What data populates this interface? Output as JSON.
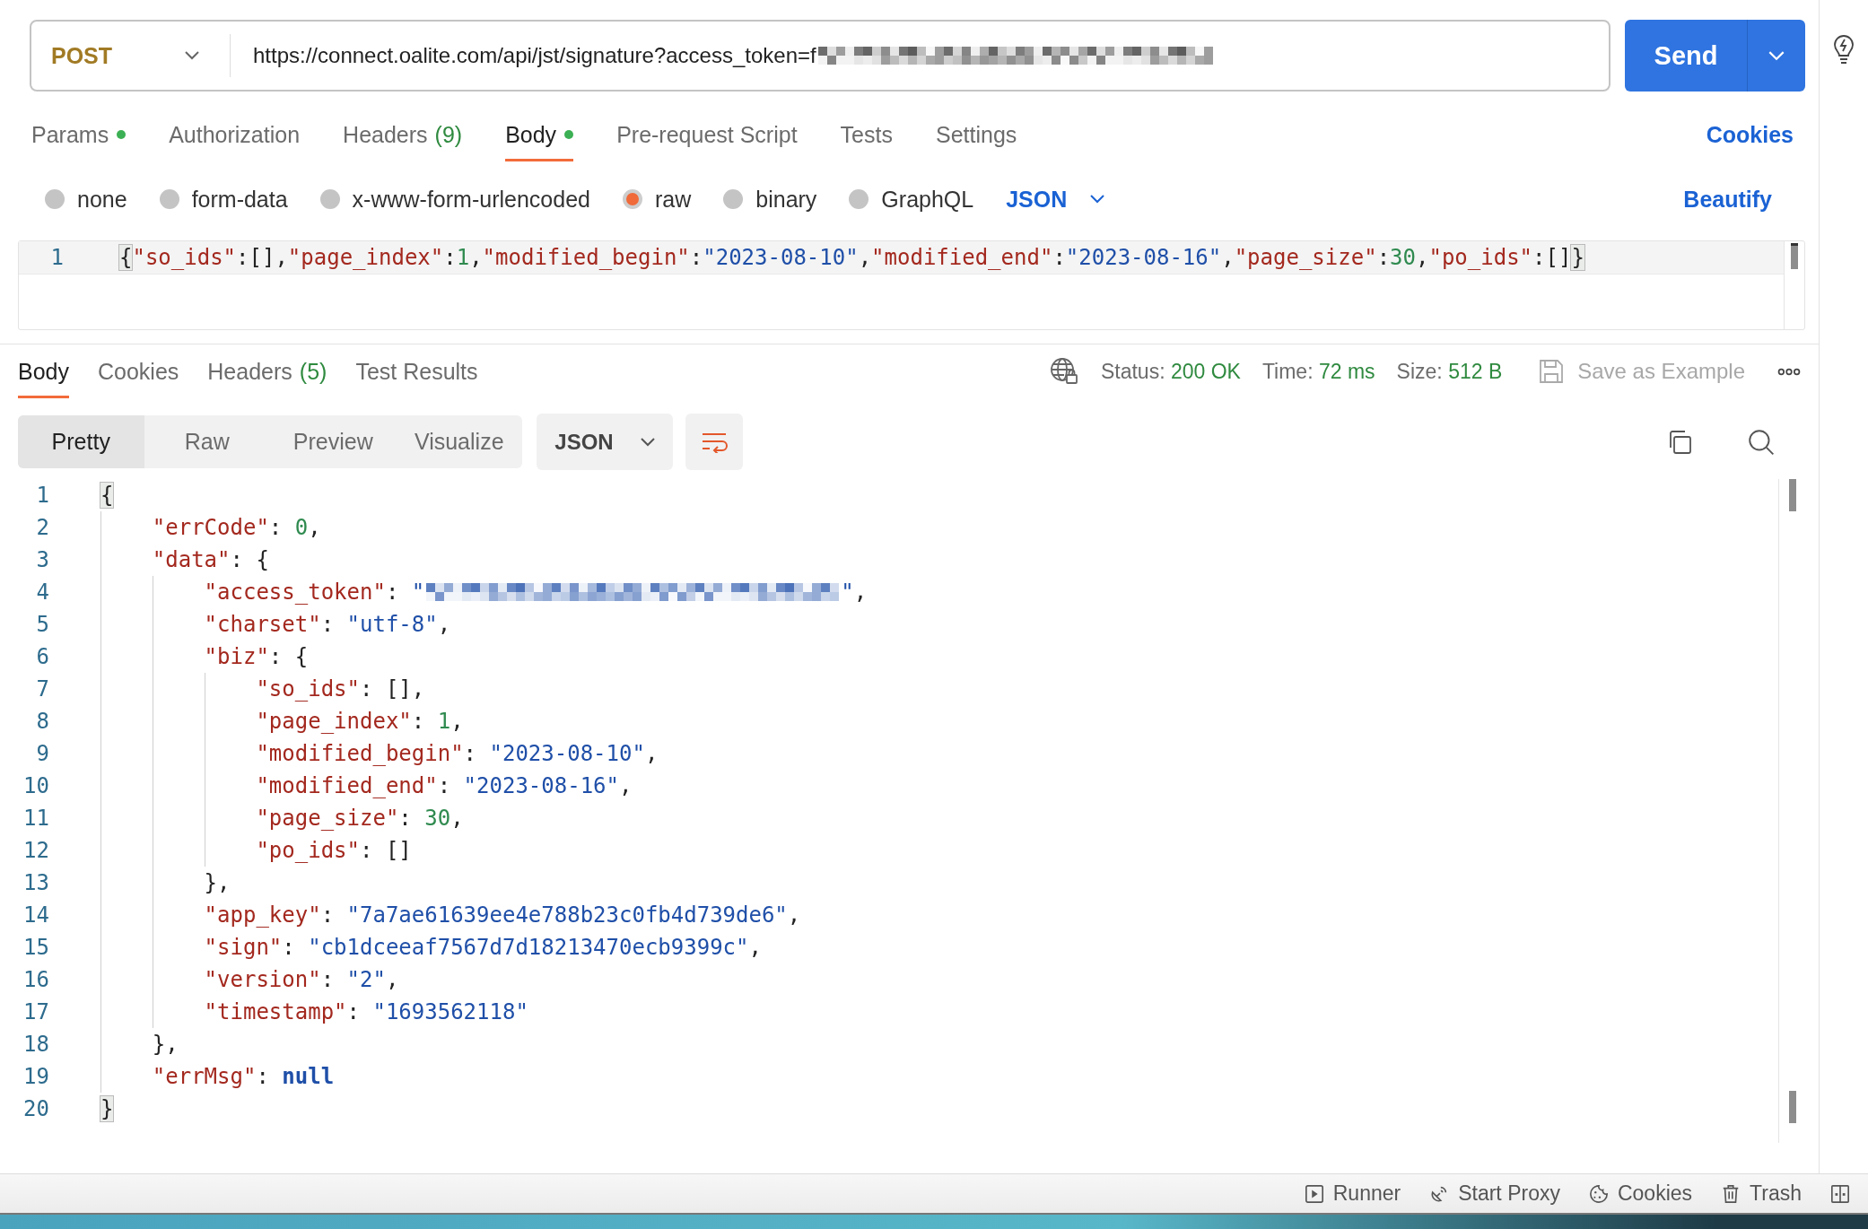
{
  "request": {
    "method": "POST",
    "url": "https://connect.oalite.com/api/jst/signature?access_token=f",
    "url_redacted": true,
    "send": "Send"
  },
  "request_tabs": [
    {
      "label": "Params",
      "dot": true,
      "selected": false
    },
    {
      "label": "Authorization",
      "dot": false,
      "selected": false
    },
    {
      "label": "Headers",
      "count": "(9)",
      "dot": false,
      "selected": false
    },
    {
      "label": "Body",
      "dot": true,
      "selected": true
    },
    {
      "label": "Pre-request Script",
      "dot": false,
      "selected": false
    },
    {
      "label": "Tests",
      "dot": false,
      "selected": false
    },
    {
      "label": "Settings",
      "dot": false,
      "selected": false
    }
  ],
  "cookies_link": "Cookies",
  "body_types": [
    {
      "label": "none",
      "selected": false
    },
    {
      "label": "form-data",
      "selected": false
    },
    {
      "label": "x-www-form-urlencoded",
      "selected": false
    },
    {
      "label": "raw",
      "selected": true
    },
    {
      "label": "binary",
      "selected": false
    },
    {
      "label": "GraphQL",
      "selected": false
    }
  ],
  "body_format": "JSON",
  "beautify": "Beautify",
  "request_body": [
    {
      "number": "1",
      "tokens": [
        {
          "kind": "brace",
          "text": "{"
        },
        {
          "kind": "key",
          "text": "\"so_ids\""
        },
        {
          "kind": "punct",
          "text": ":[],"
        },
        {
          "kind": "key",
          "text": "\"page_index\""
        },
        {
          "kind": "punct",
          "text": ":"
        },
        {
          "kind": "number",
          "text": "1"
        },
        {
          "kind": "punct",
          "text": ","
        },
        {
          "kind": "key",
          "text": "\"modified_begin\""
        },
        {
          "kind": "punct",
          "text": ":"
        },
        {
          "kind": "string",
          "text": "\"2023-08-10\""
        },
        {
          "kind": "punct",
          "text": ","
        },
        {
          "kind": "key",
          "text": "\"modified_end\""
        },
        {
          "kind": "punct",
          "text": ":"
        },
        {
          "kind": "string",
          "text": "\"2023-08-16\""
        },
        {
          "kind": "punct",
          "text": ","
        },
        {
          "kind": "key",
          "text": "\"page_size\""
        },
        {
          "kind": "punct",
          "text": ":"
        },
        {
          "kind": "number",
          "text": "30"
        },
        {
          "kind": "punct",
          "text": ","
        },
        {
          "kind": "key",
          "text": "\"po_ids\""
        },
        {
          "kind": "punct",
          "text": ":[]"
        },
        {
          "kind": "brace",
          "text": "}"
        }
      ]
    }
  ],
  "response_tabs": [
    {
      "label": "Body",
      "selected": true
    },
    {
      "label": "Cookies",
      "selected": false
    },
    {
      "label": "Headers",
      "count": "(5)",
      "selected": false
    },
    {
      "label": "Test Results",
      "selected": false
    }
  ],
  "response_meta": [
    {
      "label": "Status:",
      "value": "200 OK"
    },
    {
      "label": "Time:",
      "value": "72 ms"
    },
    {
      "label": "Size:",
      "value": "512 B"
    }
  ],
  "save_example": {
    "label": "Save as Example",
    "disabled": true
  },
  "view_tabs": [
    {
      "label": "Pretty",
      "selected": true
    },
    {
      "label": "Raw",
      "selected": false
    },
    {
      "label": "Preview",
      "selected": false
    },
    {
      "label": "Visualize",
      "selected": false
    }
  ],
  "view_format": "JSON",
  "response_body": [
    {
      "number": "1",
      "tokens": [
        {
          "kind": "brace",
          "text": "{"
        }
      ],
      "children": [
        {
          "number": "2",
          "tokens": [
            {
              "kind": "key",
              "text": "\"errCode\""
            },
            {
              "kind": "punct",
              "text": ": "
            },
            {
              "kind": "number",
              "text": "0"
            },
            {
              "kind": "punct",
              "text": ","
            }
          ]
        },
        {
          "number": "3",
          "tokens": [
            {
              "kind": "key",
              "text": "\"data\""
            },
            {
              "kind": "punct",
              "text": ": {"
            }
          ],
          "children": [
            {
              "number": "4",
              "tokens": [
                {
                  "kind": "key",
                  "text": "\"access_token\""
                },
                {
                  "kind": "punct",
                  "text": ": "
                },
                {
                  "kind": "string",
                  "text": "\""
                },
                {
                  "kind": "redacted"
                },
                {
                  "kind": "string",
                  "text": "\""
                },
                {
                  "kind": "punct",
                  "text": ","
                }
              ]
            },
            {
              "number": "5",
              "tokens": [
                {
                  "kind": "key",
                  "text": "\"charset\""
                },
                {
                  "kind": "punct",
                  "text": ": "
                },
                {
                  "kind": "string",
                  "text": "\"utf-8\""
                },
                {
                  "kind": "punct",
                  "text": ","
                }
              ]
            },
            {
              "number": "6",
              "tokens": [
                {
                  "kind": "key",
                  "text": "\"biz\""
                },
                {
                  "kind": "punct",
                  "text": ": {"
                }
              ],
              "children": [
                {
                  "number": "7",
                  "tokens": [
                    {
                      "kind": "key",
                      "text": "\"so_ids\""
                    },
                    {
                      "kind": "punct",
                      "text": ": [],"
                    }
                  ]
                },
                {
                  "number": "8",
                  "tokens": [
                    {
                      "kind": "key",
                      "text": "\"page_index\""
                    },
                    {
                      "kind": "punct",
                      "text": ": "
                    },
                    {
                      "kind": "number",
                      "text": "1"
                    },
                    {
                      "kind": "punct",
                      "text": ","
                    }
                  ]
                },
                {
                  "number": "9",
                  "tokens": [
                    {
                      "kind": "key",
                      "text": "\"modified_begin\""
                    },
                    {
                      "kind": "punct",
                      "text": ": "
                    },
                    {
                      "kind": "string",
                      "text": "\"2023-08-10\""
                    },
                    {
                      "kind": "punct",
                      "text": ","
                    }
                  ]
                },
                {
                  "number": "10",
                  "tokens": [
                    {
                      "kind": "key",
                      "text": "\"modified_end\""
                    },
                    {
                      "kind": "punct",
                      "text": ": "
                    },
                    {
                      "kind": "string",
                      "text": "\"2023-08-16\""
                    },
                    {
                      "kind": "punct",
                      "text": ","
                    }
                  ]
                },
                {
                  "number": "11",
                  "tokens": [
                    {
                      "kind": "key",
                      "text": "\"page_size\""
                    },
                    {
                      "kind": "punct",
                      "text": ": "
                    },
                    {
                      "kind": "number",
                      "text": "30"
                    },
                    {
                      "kind": "punct",
                      "text": ","
                    }
                  ]
                },
                {
                  "number": "12",
                  "tokens": [
                    {
                      "kind": "key",
                      "text": "\"po_ids\""
                    },
                    {
                      "kind": "punct",
                      "text": ": []"
                    }
                  ]
                }
              ]
            },
            {
              "number": "13",
              "tokens": [
                {
                  "kind": "punct",
                  "text": "},"
                }
              ]
            },
            {
              "number": "14",
              "tokens": [
                {
                  "kind": "key",
                  "text": "\"app_key\""
                },
                {
                  "kind": "punct",
                  "text": ": "
                },
                {
                  "kind": "string",
                  "text": "\"7a7ae61639ee4e788b23c0fb4d739de6\""
                },
                {
                  "kind": "punct",
                  "text": ","
                }
              ]
            },
            {
              "number": "15",
              "tokens": [
                {
                  "kind": "key",
                  "text": "\"sign\""
                },
                {
                  "kind": "punct",
                  "text": ": "
                },
                {
                  "kind": "string",
                  "text": "\"cb1dceeaf7567d7d18213470ecb9399c\""
                },
                {
                  "kind": "punct",
                  "text": ","
                }
              ]
            },
            {
              "number": "16",
              "tokens": [
                {
                  "kind": "key",
                  "text": "\"version\""
                },
                {
                  "kind": "punct",
                  "text": ": "
                },
                {
                  "kind": "string",
                  "text": "\"2\""
                },
                {
                  "kind": "punct",
                  "text": ","
                }
              ]
            },
            {
              "number": "17",
              "tokens": [
                {
                  "kind": "key",
                  "text": "\"timestamp\""
                },
                {
                  "kind": "punct",
                  "text": ": "
                },
                {
                  "kind": "string",
                  "text": "\"1693562118\""
                }
              ]
            }
          ]
        },
        {
          "number": "18",
          "tokens": [
            {
              "kind": "punct",
              "text": "},"
            }
          ]
        },
        {
          "number": "19",
          "tokens": [
            {
              "kind": "key",
              "text": "\"errMsg\""
            },
            {
              "kind": "punct",
              "text": ": "
            },
            {
              "kind": "null",
              "text": "null"
            }
          ]
        }
      ]
    },
    {
      "number": "20",
      "tokens": [
        {
          "kind": "brace",
          "text": "}"
        }
      ]
    }
  ],
  "status_bar": [
    {
      "kind": "runner",
      "label": "Runner"
    },
    {
      "kind": "proxy",
      "label": "Start Proxy"
    },
    {
      "kind": "cookies",
      "label": "Cookies"
    },
    {
      "kind": "trash",
      "label": "Trash"
    },
    {
      "kind": "layout"
    }
  ]
}
